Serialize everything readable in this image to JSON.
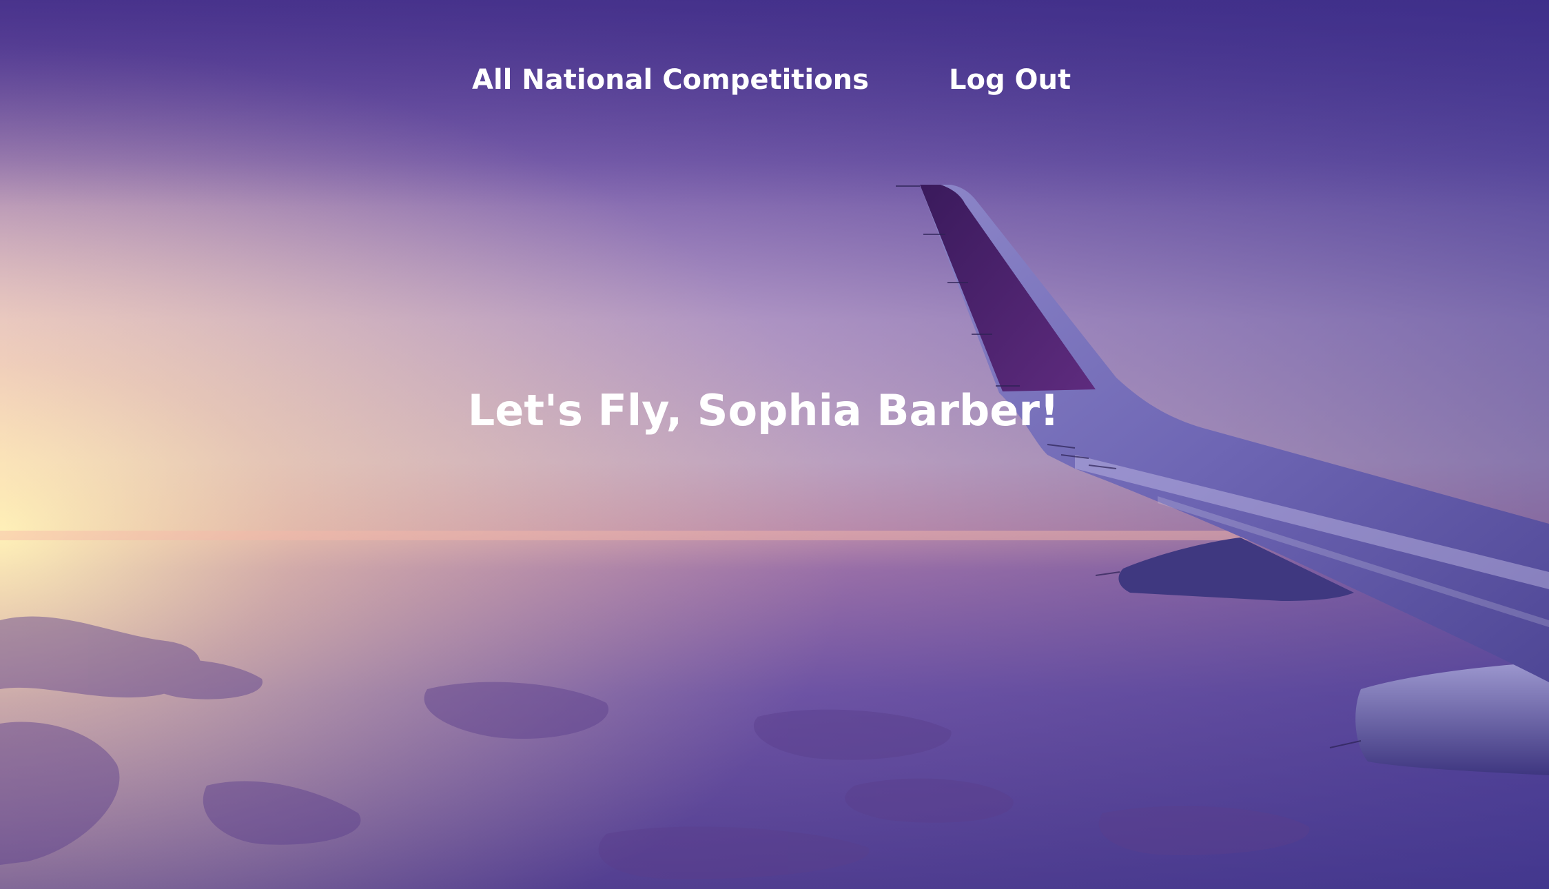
{
  "nav": {
    "links": [
      {
        "label": "All National Competitions"
      },
      {
        "label": "Log Out"
      }
    ]
  },
  "hero": {
    "greeting": "Let's Fly, Sophia Barber!",
    "background": "airplane-wing-sunset-image"
  },
  "colors": {
    "text": "#ffffff",
    "sky_top": "#4a3a96",
    "horizon_glow": "#f7e7b0",
    "pink_glow": "#f1a0b4",
    "ground": "#7a5aa6"
  }
}
